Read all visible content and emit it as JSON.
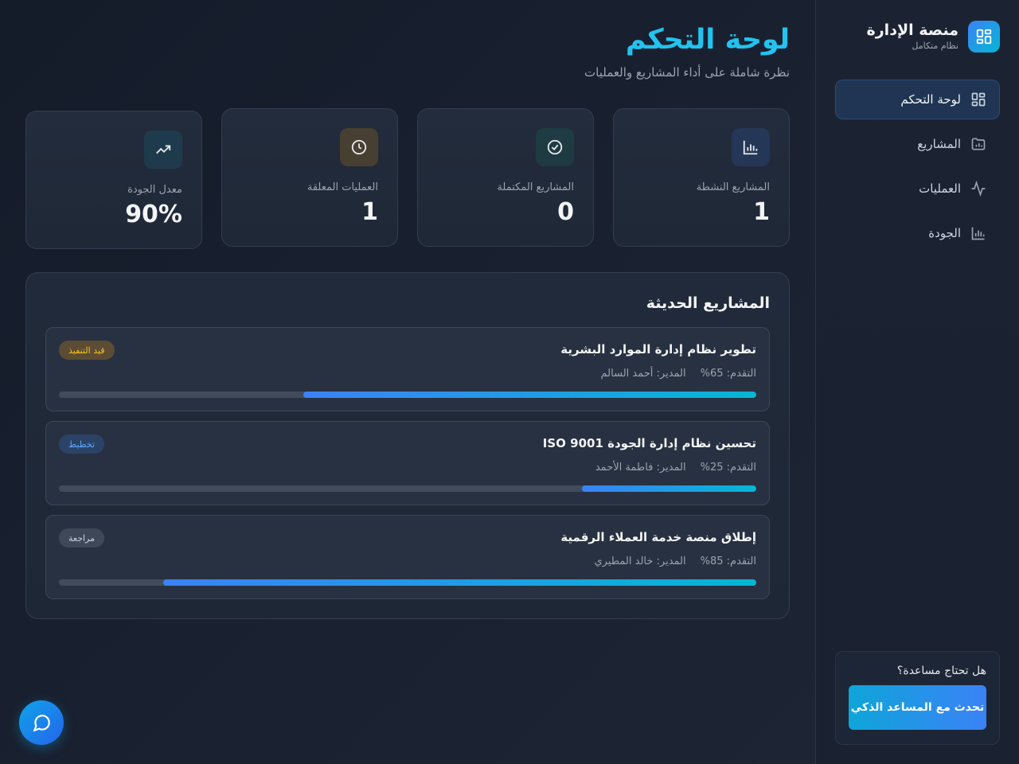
{
  "sidebar": {
    "brand_title": "منصة الإدارة",
    "brand_subtitle": "نظام متكامل",
    "items": [
      {
        "label": "لوحة التحكم",
        "icon": "dashboard-icon",
        "active": true
      },
      {
        "label": "المشاريع",
        "icon": "folder-icon",
        "active": false
      },
      {
        "label": "العمليات",
        "icon": "activity-icon",
        "active": false
      },
      {
        "label": "الجودة",
        "icon": "bar-chart-icon",
        "active": false
      }
    ],
    "help_question": "هل تحتاج مساعدة؟",
    "help_button": "تحدث مع المساعد الذكي"
  },
  "header": {
    "title": "لوحة التحكم",
    "subtitle": "نظرة شاملة على أداء المشاريع والعمليات"
  },
  "stats": [
    {
      "label": "المشاريع النشطة",
      "value": "1",
      "icon": "bar-chart-icon",
      "color": "#3b82f6"
    },
    {
      "label": "المشاريع المكتملة",
      "value": "0",
      "icon": "check-circle-icon",
      "color": "#10b981"
    },
    {
      "label": "العمليات المعلقة",
      "value": "1",
      "icon": "clock-icon",
      "color": "#f59e0b"
    },
    {
      "label": "معدل الجودة",
      "value": "90%",
      "icon": "trending-up-icon",
      "color": "#06b6d4"
    }
  ],
  "recent": {
    "title": "المشاريع الحديثة",
    "projects": [
      {
        "name": "تطوير نظام إدارة الموارد البشرية",
        "manager": "المدير: أحمد السالم",
        "progress_text": "التقدم: 65%",
        "progress": 0.65,
        "badge": "قيد التنفيذ",
        "badge_color": "#f59e0b"
      },
      {
        "name": "تحسين نظام إدارة الجودة ISO 9001",
        "manager": "المدير: فاطمة الأحمد",
        "progress_text": "التقدم: 25%",
        "progress": 0.25,
        "badge": "تخطيط",
        "badge_color": "#3b82f6"
      },
      {
        "name": "إطلاق منصة خدمة العملاء الرقمية",
        "manager": "المدير: خالد المطيري",
        "progress_text": "التقدم: 85%",
        "progress": 0.85,
        "badge": "مراجعة",
        "badge_color": "#9ca3af"
      }
    ]
  },
  "chat_button": {
    "icon": "chat-bubble-icon"
  }
}
